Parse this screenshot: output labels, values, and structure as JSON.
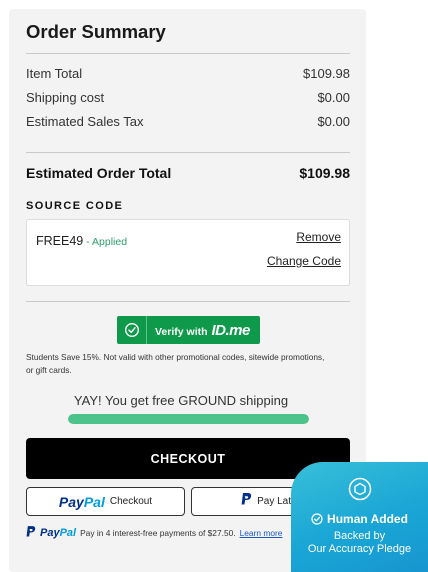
{
  "summary": {
    "title": "Order Summary",
    "rows": [
      {
        "label": "Item Total",
        "value": "$109.98"
      },
      {
        "label": "Shipping cost",
        "value": "$0.00"
      },
      {
        "label": "Estimated Sales Tax",
        "value": "$0.00"
      }
    ],
    "total_label": "Estimated Order Total",
    "total_value": "$109.98"
  },
  "source_code": {
    "heading": "SOURCE CODE",
    "code": "FREE49",
    "separator": " - ",
    "status": "Applied",
    "remove_label": "Remove",
    "change_label": "Change Code"
  },
  "idme": {
    "verify_label": "Verify with",
    "logo_text": "ID.me",
    "students_note": "Students Save 15%. Not valid with other promotional codes, sitewide promotions, or gift cards."
  },
  "shipping": {
    "message": "YAY! You get free GROUND shipping",
    "progress_percent": 100
  },
  "checkout": {
    "checkout_label": "CHECKOUT",
    "paypal_pay": "Pay",
    "paypal_pal": "Pal",
    "paypal_checkout_label": "Checkout",
    "paylater_label": "Pay Later"
  },
  "pay_in_4": {
    "text": "Pay in 4 interest-free payments of $27.50.",
    "learn_more": "Learn more"
  },
  "badge": {
    "line1": "Human Added",
    "line2": "Backed by",
    "line3": "Our Accuracy Pledge"
  },
  "colors": {
    "panel_bg": "#f3f3f3",
    "applied_green": "#2e9e6a",
    "idme_green": "#0e9a4a",
    "progress_green": "#4cc38a",
    "checkout_black": "#000000",
    "paypal_navy": "#003087",
    "paypal_light": "#009cde",
    "badge_blue": "#1aa6d6"
  }
}
